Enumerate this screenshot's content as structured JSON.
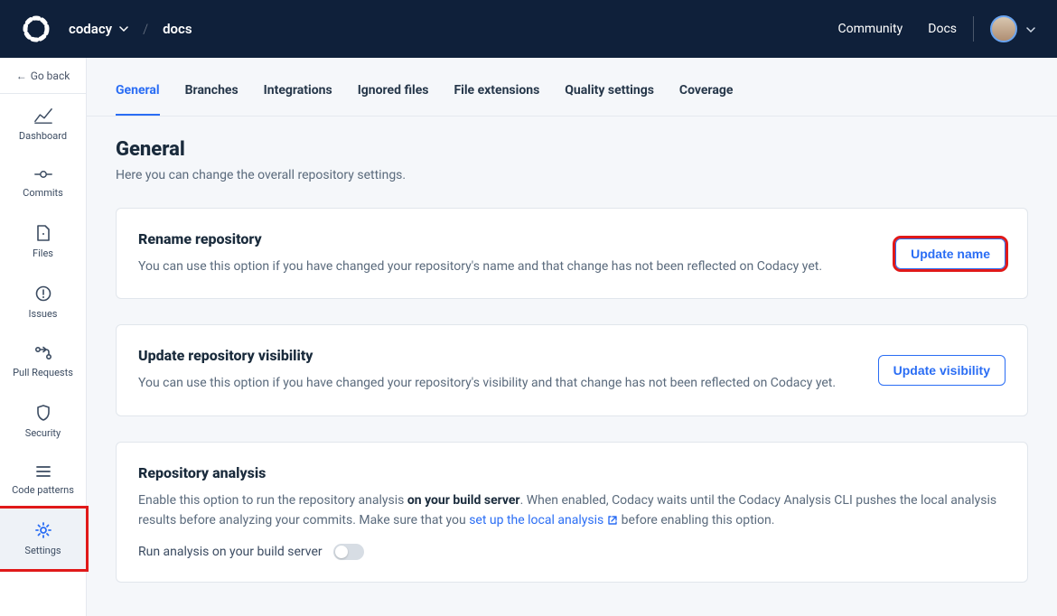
{
  "header": {
    "org": "codacy",
    "repo": "docs",
    "links": {
      "community": "Community",
      "docs": "Docs"
    }
  },
  "sidebar": {
    "goback": "Go back",
    "items": [
      {
        "label": "Dashboard"
      },
      {
        "label": "Commits"
      },
      {
        "label": "Files"
      },
      {
        "label": "Issues"
      },
      {
        "label": "Pull Requests"
      },
      {
        "label": "Security"
      },
      {
        "label": "Code patterns"
      },
      {
        "label": "Settings"
      }
    ]
  },
  "tabs": [
    "General",
    "Branches",
    "Integrations",
    "Ignored files",
    "File extensions",
    "Quality settings",
    "Coverage"
  ],
  "page": {
    "title": "General",
    "subtitle": "Here you can change the overall repository settings."
  },
  "cards": {
    "rename": {
      "title": "Rename repository",
      "desc": "You can use this option if you have changed your repository's name and that change has not been reflected on Codacy yet.",
      "button": "Update name"
    },
    "visibility": {
      "title": "Update repository visibility",
      "desc": "You can use this option if you have changed your repository's visibility and that change has not been reflected on Codacy yet.",
      "button": "Update visibility"
    },
    "analysis": {
      "title": "Repository analysis",
      "desc_a": "Enable this option to run the repository analysis ",
      "bold": "on your build server",
      "desc_b": ". When enabled, Codacy waits until the Codacy Analysis CLI pushes the local analysis results before analyzing your commits. Make sure that you ",
      "link": "set up the local analysis",
      "desc_c": " before enabling this option.",
      "toggle_label": "Run analysis on your build server"
    }
  }
}
